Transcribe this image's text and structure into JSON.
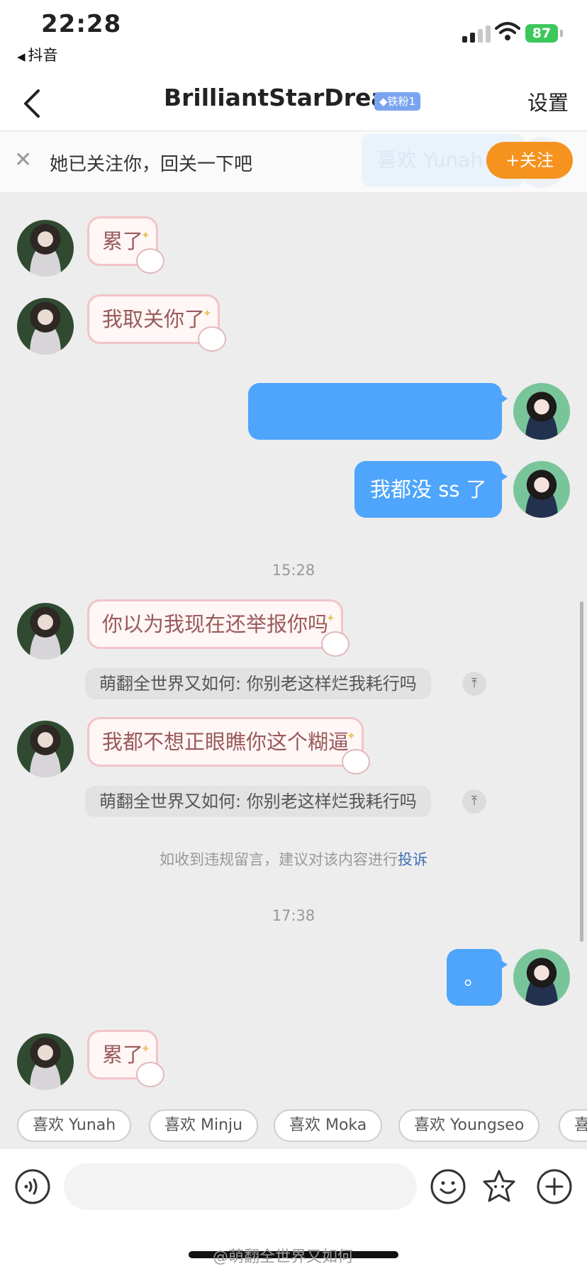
{
  "status_bar": {
    "time": "22:28",
    "back_app": "抖音",
    "battery": "87"
  },
  "nav": {
    "title": "BrilliantStarDream",
    "badge": "铁粉1",
    "settings": "设置"
  },
  "follow_bar": {
    "message": "她已关注你，回关一下吧",
    "ghost_text": "喜欢 Yunah",
    "follow_button": "+关注"
  },
  "messages": [
    {
      "side": "left",
      "text": "累了"
    },
    {
      "side": "left",
      "text": "我取关你了"
    },
    {
      "side": "right",
      "text": ""
    },
    {
      "side": "right",
      "text": "我都没 ss 了"
    },
    {
      "type": "time",
      "text": "15:28"
    },
    {
      "side": "left",
      "text": "你以为我现在还举报你吗",
      "quote": "萌翻全世界又如何: 你别老这样烂我耗行吗"
    },
    {
      "side": "left",
      "text": "我都不想正眼瞧你这个糊逼",
      "quote": "萌翻全世界又如何: 你别老这样烂我耗行吗"
    },
    {
      "type": "notice",
      "text": "如收到违规留言，建议对该内容进行",
      "link": "投诉"
    },
    {
      "type": "time",
      "text": "17:38"
    },
    {
      "side": "right",
      "text": "。"
    },
    {
      "side": "left",
      "text": "累了"
    }
  ],
  "quick_replies": [
    "喜欢 Yunah",
    "喜欢 Minju",
    "喜欢 Moka",
    "喜欢 Youngseo",
    "喜"
  ],
  "watermark": "@萌翻全世界又如何",
  "colors": {
    "accent_orange": "#f6921e",
    "sent_bubble": "#4ea5fb",
    "link_blue": "#3e6fb7",
    "badge_blue": "#7aa4f0"
  },
  "icons": [
    "back-arrow-icon",
    "wifi-icon",
    "close-icon",
    "pin-top-icon",
    "voice-icon",
    "emoji-icon",
    "sticker-icon",
    "plus-icon"
  ]
}
